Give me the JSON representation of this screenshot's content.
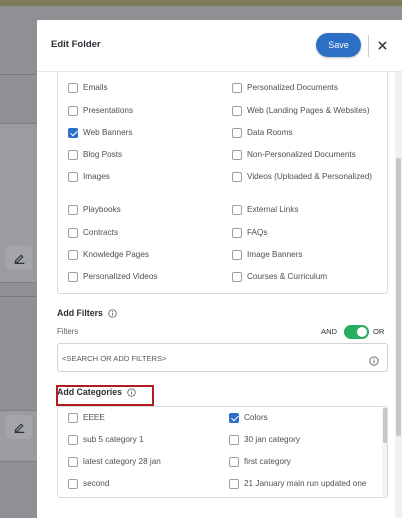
{
  "modal": {
    "title": "Edit Folder",
    "save_label": "Save"
  },
  "content_types": [
    {
      "label": "Emails",
      "checked": false
    },
    {
      "label": "Personalized Documents",
      "checked": false
    },
    {
      "label": "Presentations",
      "checked": false
    },
    {
      "label": "Web (Landing Pages & Websites)",
      "checked": false
    },
    {
      "label": "Web Banners",
      "checked": true
    },
    {
      "label": "Data Rooms",
      "checked": false
    },
    {
      "label": "Blog Posts",
      "checked": false
    },
    {
      "label": "Non-Personalized Documents",
      "checked": false
    },
    {
      "label": "Images",
      "checked": false
    },
    {
      "label": "Videos (Uploaded & Personalized)",
      "checked": false
    },
    {
      "label": "Playbooks",
      "checked": false
    },
    {
      "label": "External Links",
      "checked": false
    },
    {
      "label": "Contracts",
      "checked": false
    },
    {
      "label": "FAQs",
      "checked": false
    },
    {
      "label": "Knowledge Pages",
      "checked": false
    },
    {
      "label": "Image Banners",
      "checked": false
    },
    {
      "label": "Personalized Videos",
      "checked": false
    },
    {
      "label": "Courses & Curriculum",
      "checked": false
    }
  ],
  "filters": {
    "title": "Add Filters",
    "label": "Filters",
    "and_label": "AND",
    "or_label": "OR",
    "toggle_on": true,
    "placeholder": "<SEARCH OR ADD FILTERS>"
  },
  "categories": {
    "title": "Add Categories",
    "items": [
      {
        "label": "EEEE",
        "checked": false
      },
      {
        "label": "Colors",
        "checked": true
      },
      {
        "label": "sub 5 category 1",
        "checked": false
      },
      {
        "label": "30 jan category",
        "checked": false
      },
      {
        "label": "latest category 28 jan",
        "checked": false
      },
      {
        "label": "first category",
        "checked": false
      },
      {
        "label": "second",
        "checked": false
      },
      {
        "label": "21 January main run updated one",
        "checked": false
      }
    ]
  },
  "colors": {
    "accent": "#2d6fc4",
    "toggle": "#27ae60",
    "highlight": "#b01e22"
  }
}
